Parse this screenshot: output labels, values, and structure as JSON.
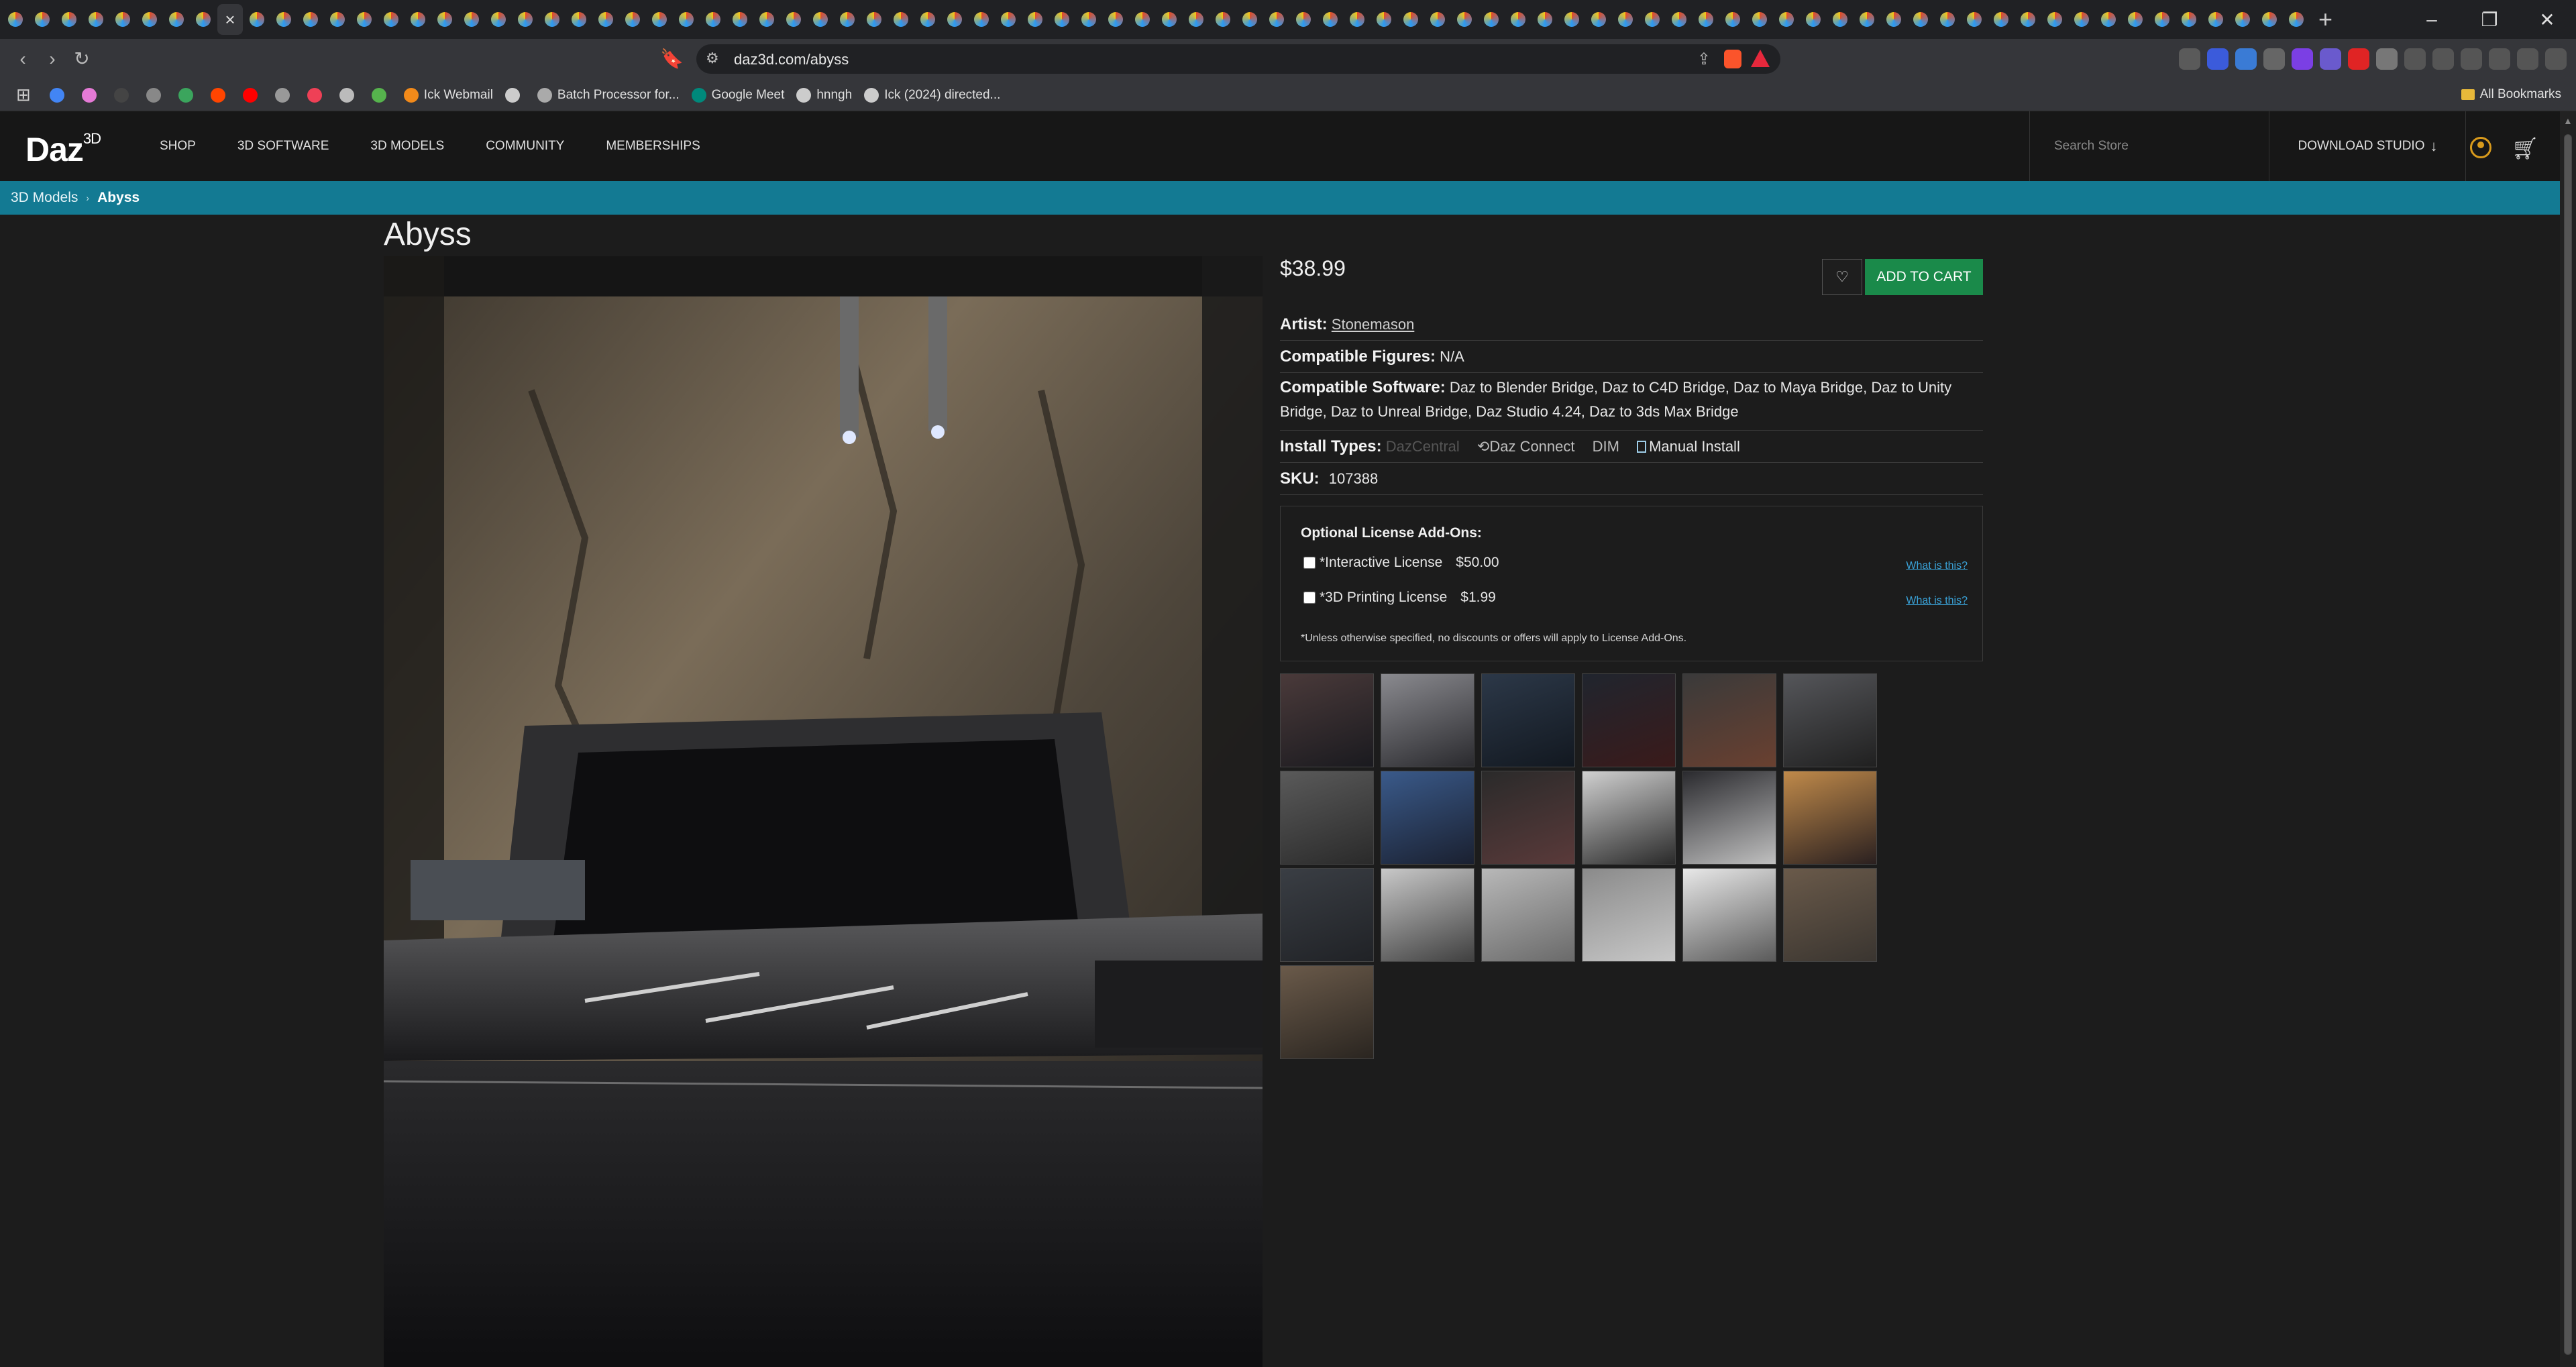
{
  "browser": {
    "url": "daz3d.com/abyss",
    "bookmarks": [
      {
        "label": "",
        "icon": "google-icon",
        "color": "#4285f4"
      },
      {
        "label": "",
        "icon": "ghost-icon",
        "color": "#e57ad6"
      },
      {
        "label": "",
        "icon": "dark-circle-icon",
        "color": "#444"
      },
      {
        "label": "",
        "icon": "chat-icon",
        "color": "#888"
      },
      {
        "label": "",
        "icon": "game-icon",
        "color": "#3ba55d"
      },
      {
        "label": "",
        "icon": "reddit-icon",
        "color": "#ff4500"
      },
      {
        "label": "",
        "icon": "youtube-icon",
        "color": "#ff0000"
      },
      {
        "label": "",
        "icon": "archive-icon",
        "color": "#999"
      },
      {
        "label": "",
        "icon": "pocket-icon",
        "color": "#ef4056"
      },
      {
        "label": "",
        "icon": "circle-a-icon",
        "color": "#bbb"
      },
      {
        "label": "",
        "icon": "colorful-icon",
        "color": "#56b34d"
      },
      {
        "label": "Ick Webmail",
        "icon": "webmail-icon",
        "color": "#f28a1a"
      },
      {
        "label": "",
        "icon": "globe-icon",
        "color": "#ccc"
      },
      {
        "label": "Batch Processor for...",
        "icon": "batch-icon",
        "color": "#aaa"
      },
      {
        "label": "Google Meet",
        "icon": "meet-icon",
        "color": "#00897b"
      },
      {
        "label": "hnngh",
        "icon": "globe-icon",
        "color": "#ccc"
      },
      {
        "label": "Ick (2024) directed...",
        "icon": "globe-icon",
        "color": "#ccc"
      }
    ],
    "all_bookmarks": "All Bookmarks"
  },
  "site": {
    "logo": "Daz",
    "logo_sup": "3D",
    "nav": [
      "SHOP",
      "3D SOFTWARE",
      "3D MODELS",
      "COMMUNITY",
      "MEMBERSHIPS"
    ],
    "search_placeholder": "Search Store",
    "download": "DOWNLOAD STUDIO"
  },
  "breadcrumb": {
    "parent": "3D Models",
    "current": "Abyss"
  },
  "product": {
    "title": "Abyss",
    "price": "$38.99",
    "add_to_cart": "ADD TO CART",
    "artist_label": "Artist:",
    "artist": "Stonemason",
    "figures_label": "Compatible Figures:",
    "figures": "N/A",
    "software_label": "Compatible Software:",
    "software": "Daz to Blender Bridge, Daz to C4D Bridge, Daz to Maya Bridge, Daz to Unity Bridge, Daz to Unreal Bridge, Daz Studio 4.24, Daz to 3ds Max Bridge",
    "install_label": "Install Types:",
    "install_types": [
      "DazCentral",
      "Daz Connect",
      "DIM",
      "Manual Install"
    ],
    "sku_label": "SKU:",
    "sku": "107388",
    "addons_title": "Optional License Add-Ons:",
    "licenses": [
      {
        "label": "*Interactive License",
        "price": "$50.00",
        "link": "What is this?"
      },
      {
        "label": "*3D Printing License",
        "price": "$1.99",
        "link": "What is this?"
      }
    ],
    "addons_note": "*Unless otherwise specified, no discounts or offers will apply to License Add-Ons."
  },
  "thumbnails": [
    {
      "tone": [
        "#4a3a3a",
        "#1a1a1f"
      ]
    },
    {
      "tone": [
        "#8a8a8f",
        "#2a2a2e"
      ]
    },
    {
      "tone": [
        "#2c3848",
        "#121820"
      ]
    },
    {
      "tone": [
        "#20252e",
        "#3a1a1a"
      ]
    },
    {
      "tone": [
        "#3a3a3a",
        "#6a4030"
      ]
    },
    {
      "tone": [
        "#55565a",
        "#202020"
      ]
    },
    {
      "tone": [
        "#5a5a5a",
        "#2a2a2a"
      ]
    },
    {
      "tone": [
        "#3a5a8a",
        "#1a2030"
      ]
    },
    {
      "tone": [
        "#2a2a2a",
        "#5a3a3a"
      ]
    },
    {
      "tone": [
        "#d0d0d0",
        "#2a2a2a"
      ]
    },
    {
      "tone": [
        "#2a2a2e",
        "#c0c0c0"
      ]
    },
    {
      "tone": [
        "#c08a4a",
        "#2a2020"
      ]
    },
    {
      "tone": [
        "#3a3e44",
        "#202226"
      ]
    },
    {
      "tone": [
        "#c8c8c8",
        "#404040"
      ]
    },
    {
      "tone": [
        "#b8b8b8",
        "#6a6a6a"
      ]
    },
    {
      "tone": [
        "#8a8a8a",
        "#c8c8c8"
      ]
    },
    {
      "tone": [
        "#e8e8e8",
        "#5a5a5a"
      ]
    },
    {
      "tone": [
        "#6a5a4a",
        "#3a3530"
      ]
    },
    {
      "tone": [
        "#6a5a4a",
        "#2a2520"
      ]
    }
  ]
}
